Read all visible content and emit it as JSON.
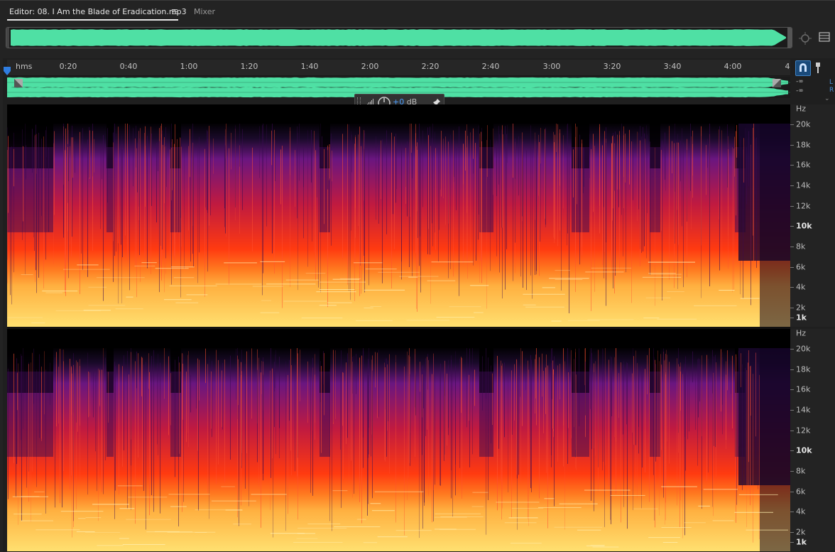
{
  "tabs": {
    "editor_label": "Editor: 08. I Am the Blade of Eradication.mp3",
    "editor_menu_icon": "hamburger-icon",
    "mixer_label": "Mixer"
  },
  "ruler": {
    "unit": "hms",
    "ticks": [
      "0:20",
      "0:40",
      "1:00",
      "1:20",
      "1:40",
      "2:00",
      "2:20",
      "2:40",
      "3:00",
      "3:20",
      "3:40",
      "4:00",
      "4"
    ]
  },
  "levels": {
    "left": "-∞",
    "right": "-∞",
    "channel_left": "L",
    "channel_right": "R"
  },
  "hud": {
    "value": "+0",
    "unit": "dB"
  },
  "frequency_axis": {
    "unit": "Hz",
    "labels": [
      "20k",
      "18k",
      "16k",
      "14k",
      "12k",
      "10k",
      "8k",
      "6k",
      "4k",
      "2k",
      "1k"
    ],
    "strong": [
      "10k",
      "1k"
    ]
  },
  "colors": {
    "waveform": "#4fe0a4",
    "accent": "#4a9eff",
    "spectrum_low": "#000000",
    "spectrum_mid": "#7a1a8a",
    "spectrum_high": "#ff2a10",
    "spectrum_peak": "#ffe070"
  },
  "icons": {
    "zoom": "zoom-to-selection-icon",
    "settings": "panel-menu-icon",
    "snap": "snap-magnet-icon",
    "marker": "marker-pin-icon",
    "playhead": "playhead-icon",
    "meter": "level-meter-icon",
    "knob": "volume-knob-icon",
    "pin": "pin-icon"
  }
}
